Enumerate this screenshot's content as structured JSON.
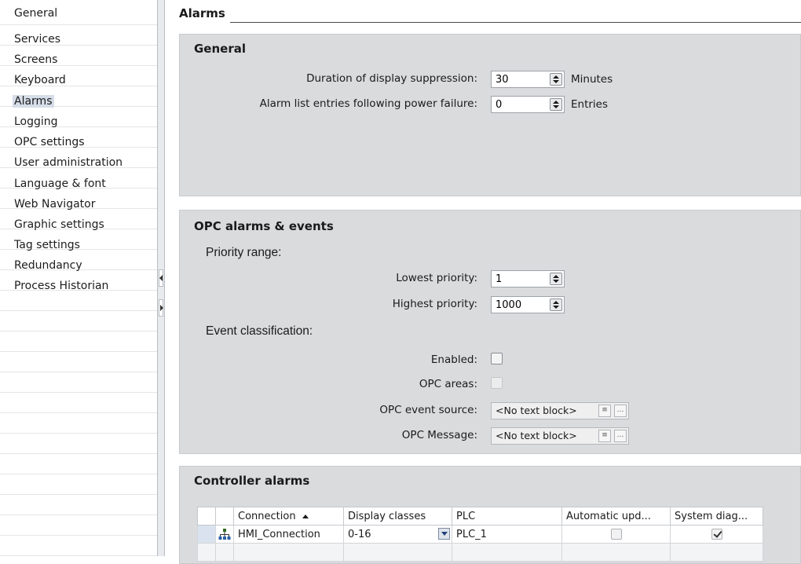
{
  "sidebar": {
    "items": [
      {
        "label": "General"
      },
      {
        "label": "Services"
      },
      {
        "label": "Screens"
      },
      {
        "label": "Keyboard"
      },
      {
        "label": "Alarms"
      },
      {
        "label": "Logging"
      },
      {
        "label": "OPC settings"
      },
      {
        "label": "User administration"
      },
      {
        "label": "Language & font"
      },
      {
        "label": "Web Navigator"
      },
      {
        "label": "Graphic settings"
      },
      {
        "label": "Tag settings"
      },
      {
        "label": "Redundancy"
      },
      {
        "label": "Process Historian"
      }
    ],
    "selected": "Alarms"
  },
  "page": {
    "title": "Alarms"
  },
  "general": {
    "title": "General",
    "suppression_label": "Duration of display suppression:",
    "suppression_value": "30",
    "suppression_unit": "Minutes",
    "power_failure_label": "Alarm list entries following power failure:",
    "power_failure_value": "0",
    "power_failure_unit": "Entries"
  },
  "opc": {
    "title": "OPC alarms & events",
    "priority_heading": "Priority range:",
    "lowest_label": "Lowest priority:",
    "lowest_value": "1",
    "highest_label": "Highest priority:",
    "highest_value": "1000",
    "event_heading": "Event classification:",
    "enabled_label": "Enabled:",
    "areas_label": "OPC areas:",
    "event_source_label": "OPC event source:",
    "event_source_value": "<No text block>",
    "message_label": "OPC Message:",
    "message_value": "<No text block>"
  },
  "controller": {
    "title": "Controller alarms",
    "columns": [
      "Connection",
      "Display classes",
      "PLC",
      "Automatic upd...",
      "System diag..."
    ],
    "rows": [
      {
        "connection": "HMI_Connection",
        "display_classes": "0-16",
        "plc": "PLC_1",
        "automatic_update": false,
        "system_diagnostics": true
      }
    ]
  },
  "colors": {
    "section_bg": "#d9dbdd",
    "selection": "#d5dde8"
  }
}
